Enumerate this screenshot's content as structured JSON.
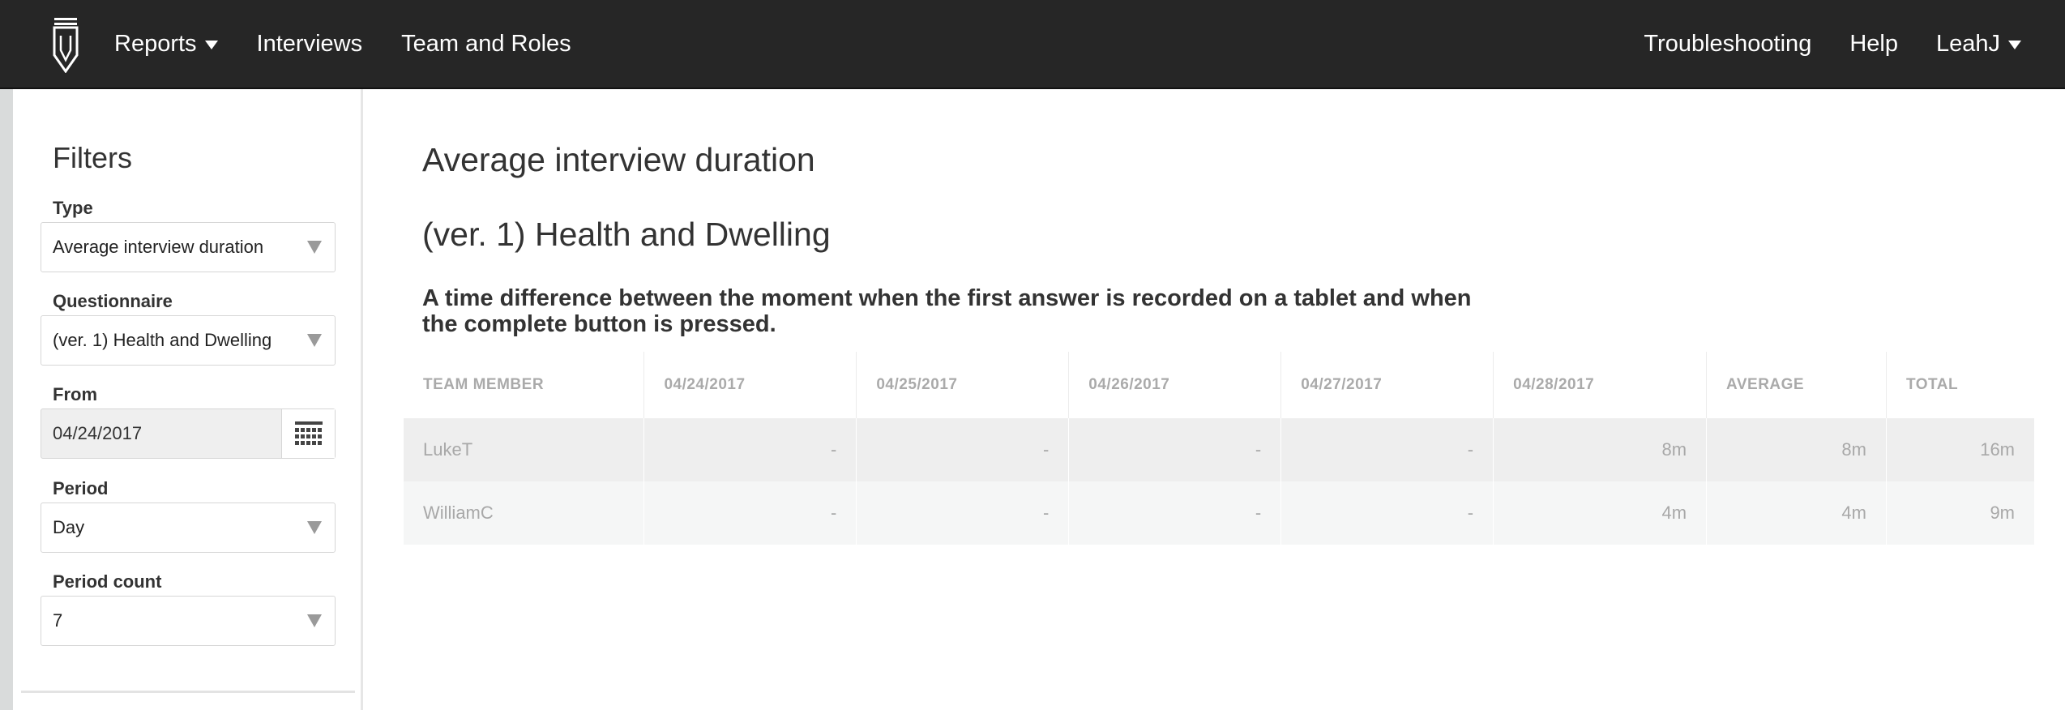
{
  "nav": {
    "logo_icon": "pen-nib-logo",
    "left": [
      {
        "label": "Reports",
        "has_caret": true
      },
      {
        "label": "Interviews"
      },
      {
        "label": "Team and Roles"
      }
    ],
    "right": [
      {
        "label": "Troubleshooting"
      },
      {
        "label": "Help"
      },
      {
        "label": "LeahJ",
        "has_caret": true
      }
    ]
  },
  "sidebar": {
    "title": "Filters",
    "type": {
      "label": "Type",
      "value": "Average interview duration"
    },
    "questionnaire": {
      "label": "Questionnaire",
      "value": "(ver. 1) Health and Dwelling"
    },
    "from": {
      "label": "From",
      "value": "04/24/2017",
      "icon": "calendar-icon"
    },
    "period": {
      "label": "Period",
      "value": "Day"
    },
    "period_count": {
      "label": "Period count",
      "value": "7"
    }
  },
  "main": {
    "title": "Average interview duration",
    "subtitle": "(ver. 1) Health and Dwelling",
    "description": "A time difference between the moment when the first answer is recorded on a tablet and when the complete button is pressed.",
    "table": {
      "columns": [
        "TEAM MEMBER",
        "04/24/2017",
        "04/25/2017",
        "04/26/2017",
        "04/27/2017",
        "04/28/2017",
        "AVERAGE",
        "TOTAL"
      ],
      "rows": [
        [
          "LukeT",
          "-",
          "-",
          "-",
          "-",
          "8m",
          "8m",
          "16m"
        ],
        [
          "WilliamC",
          "-",
          "-",
          "-",
          "-",
          "4m",
          "4m",
          "9m"
        ]
      ]
    }
  },
  "colors": {
    "topbar": "#262626",
    "row_a": "#eeeeee",
    "row_b": "#f5f6f6"
  }
}
